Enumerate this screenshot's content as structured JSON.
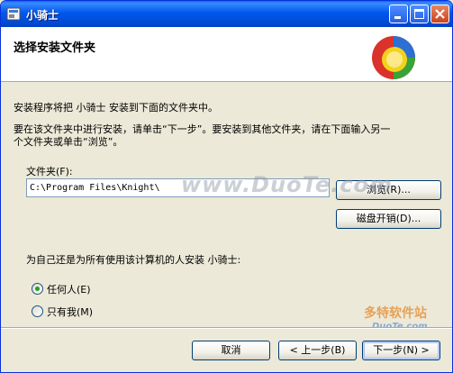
{
  "window": {
    "title": "小骑士"
  },
  "header": {
    "title": "选择安装文件夹"
  },
  "intro": {
    "line1": "安装程序将把 小骑士 安装到下面的文件夹中。",
    "line2a": "要在该文件夹中进行安装，请单击“下一步”。要安装到其他文件夹，请在下面输入另一",
    "line2b": "个文件夹或单击“浏览”。"
  },
  "folder": {
    "label": "文件夹(F):",
    "value": "C:\\Program Files\\Knight\\",
    "browse_label": "浏览(R)...",
    "disk_cost_label": "磁盘开销(D)..."
  },
  "scope": {
    "question": "为自己还是为所有使用该计算机的人安装 小骑士:",
    "options": [
      {
        "label": "任何人(E)",
        "selected": true
      },
      {
        "label": "只有我(M)",
        "selected": false
      }
    ]
  },
  "footer": {
    "cancel_label": "取消",
    "back_label": "< 上一步(B)",
    "next_label": "下一步(N) >"
  },
  "watermarks": {
    "duote_main": "www.DuoTe.com",
    "duote_small": "DuoTe.com",
    "duote_cn": "多特软件站"
  },
  "colors": {
    "titlebar": "#0058ee",
    "accent": "#21a121",
    "face": "#ece9d8"
  },
  "icons": [
    "app-icon",
    "minimize-icon",
    "maximize-icon",
    "close-icon",
    "installer-logo-icon"
  ]
}
